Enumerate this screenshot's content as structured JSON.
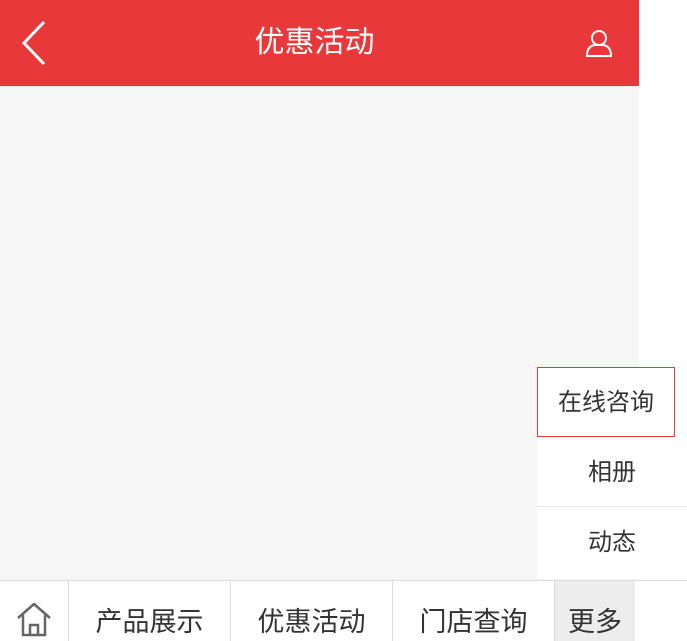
{
  "header": {
    "title": "优惠活动",
    "back_icon": "chevron-left-icon",
    "user_icon": "user-icon",
    "color": "#e8383a"
  },
  "popup_menu": {
    "items": [
      {
        "label": "在线咨询"
      },
      {
        "label": "相册"
      },
      {
        "label": "动态"
      }
    ]
  },
  "bottom_nav": {
    "home_icon": "home-icon",
    "tabs": [
      {
        "label": "产品展示"
      },
      {
        "label": "优惠活动"
      },
      {
        "label": "门店查询"
      },
      {
        "label": "更多"
      }
    ]
  }
}
